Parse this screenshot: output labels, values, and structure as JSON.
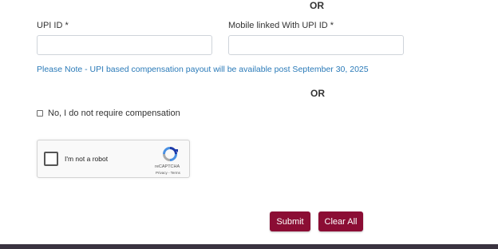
{
  "or_top": "OR",
  "upi": {
    "label": "UPI ID *",
    "value": "",
    "placeholder": ""
  },
  "mobile": {
    "label": "Mobile linked With UPI ID *",
    "value": "",
    "placeholder": ""
  },
  "note": "Please Note - UPI based compensation payout will be available post September 30, 2025",
  "or_middle": "OR",
  "no_compensation": {
    "label": "No, I do not require compensation",
    "checked": false
  },
  "recaptcha": {
    "label": "I'm not a robot",
    "brand": "reCAPTCHA",
    "links": "Privacy - Terms",
    "icon": "recaptcha-logo-icon"
  },
  "buttons": {
    "submit": "Submit",
    "clear": "Clear All"
  },
  "colors": {
    "button_bg": "#8b0d34",
    "note_text": "#2a7ab8",
    "footer": "#3a3340"
  }
}
